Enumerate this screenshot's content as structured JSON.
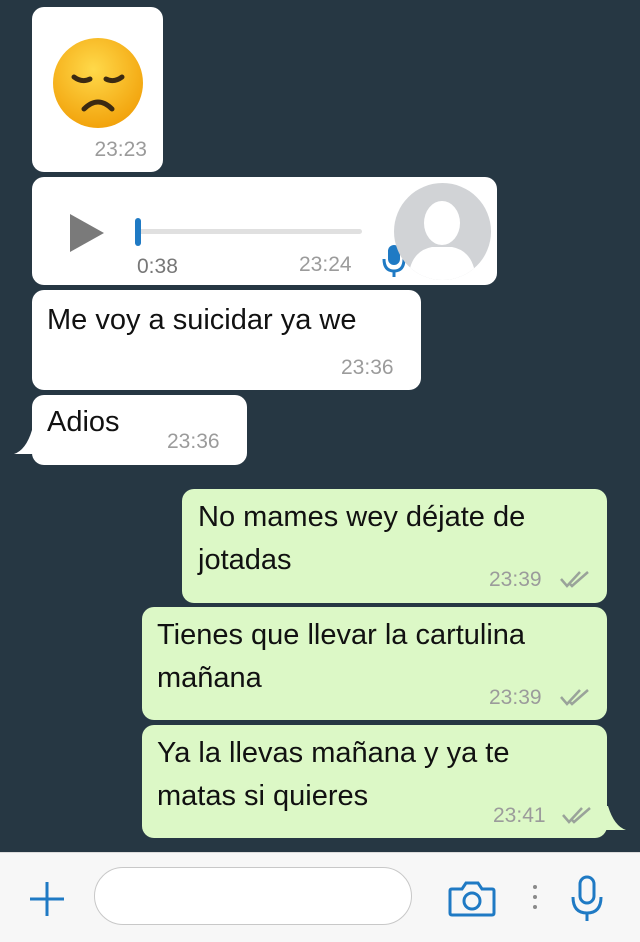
{
  "colors": {
    "background": "#263743",
    "incoming_bubble": "#ffffff",
    "outgoing_bubble": "#dcf8c6",
    "accent": "#1f7ac4",
    "timestamp": "#9b9b9b"
  },
  "messages": [
    {
      "type": "emoji",
      "direction": "incoming",
      "icon": "disappointed-face-emoji",
      "time": "23:23"
    },
    {
      "type": "voice",
      "direction": "incoming",
      "duration": "0:38",
      "time": "23:24",
      "progress": 0.0,
      "icon": "microphone-icon",
      "avatar": "default-avatar"
    },
    {
      "type": "text",
      "direction": "incoming",
      "lines": [
        "Me voy a suicidar ya we"
      ],
      "time": "23:36"
    },
    {
      "type": "text",
      "direction": "incoming",
      "lines": [
        "Adios"
      ],
      "time": "23:36"
    },
    {
      "type": "text",
      "direction": "outgoing",
      "lines": [
        "No mames wey déjate de",
        "jotadas"
      ],
      "time": "23:39",
      "status": "read"
    },
    {
      "type": "text",
      "direction": "outgoing",
      "lines": [
        "Tienes que llevar la cartulina",
        "mañana"
      ],
      "time": "23:39",
      "status": "read"
    },
    {
      "type": "text",
      "direction": "outgoing",
      "lines": [
        "Ya la llevas mañana y ya te",
        "matas si quieres"
      ],
      "time": "23:41",
      "status": "read"
    }
  ],
  "input_bar": {
    "add_icon": "plus-icon",
    "message_placeholder": "",
    "camera_icon": "camera-icon",
    "more_icon": "more-icon",
    "mic_icon": "microphone-icon"
  }
}
